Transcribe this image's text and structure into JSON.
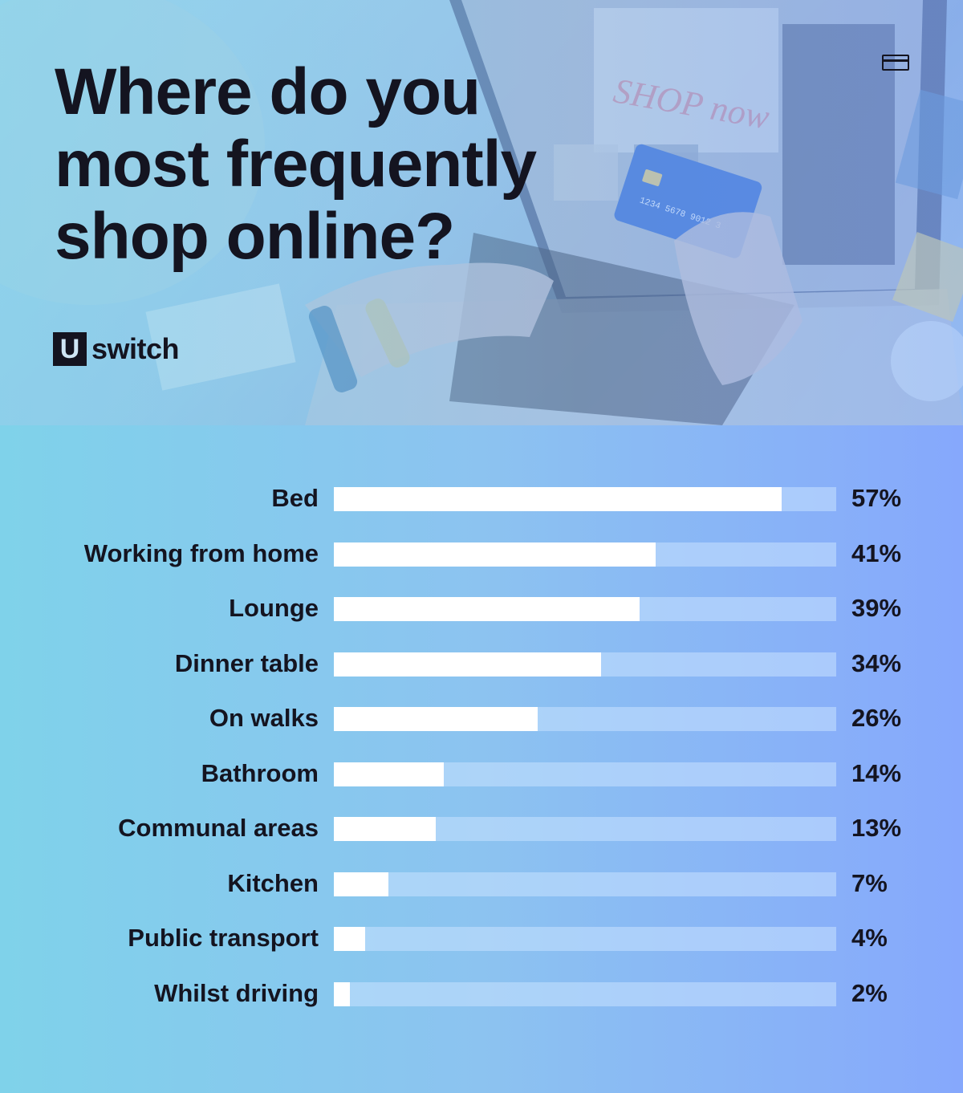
{
  "header": {
    "title_lines": [
      "Where do you",
      "most frequently",
      "shop online?"
    ],
    "logo": {
      "box_letter": "U",
      "word": "switch"
    },
    "icons": [
      "credit-card-icon"
    ]
  },
  "colors": {
    "title_text": "#141420",
    "bar_fill": "#ffffff",
    "bar_track": "#a9cdfb",
    "bg_left": "#7fd2ea",
    "bg_right": "#86a8fc"
  },
  "chart_data": {
    "type": "bar",
    "orientation": "horizontal",
    "title": "Where do you most frequently shop online?",
    "xlabel": "",
    "ylabel": "",
    "xlim": [
      0,
      64
    ],
    "value_suffix": "%",
    "categories": [
      "Bed",
      "Working from home",
      "Lounge",
      "Dinner table",
      "On walks",
      "Bathroom",
      "Communal areas",
      "Kitchen",
      "Public transport",
      "Whilst driving"
    ],
    "values": [
      57,
      41,
      39,
      34,
      26,
      14,
      13,
      7,
      4,
      2
    ],
    "value_labels": [
      "57%",
      "41%",
      "39%",
      "34%",
      "26%",
      "14%",
      "13%",
      "7%",
      "4%",
      "2%"
    ],
    "grid": false,
    "legend": "none"
  }
}
